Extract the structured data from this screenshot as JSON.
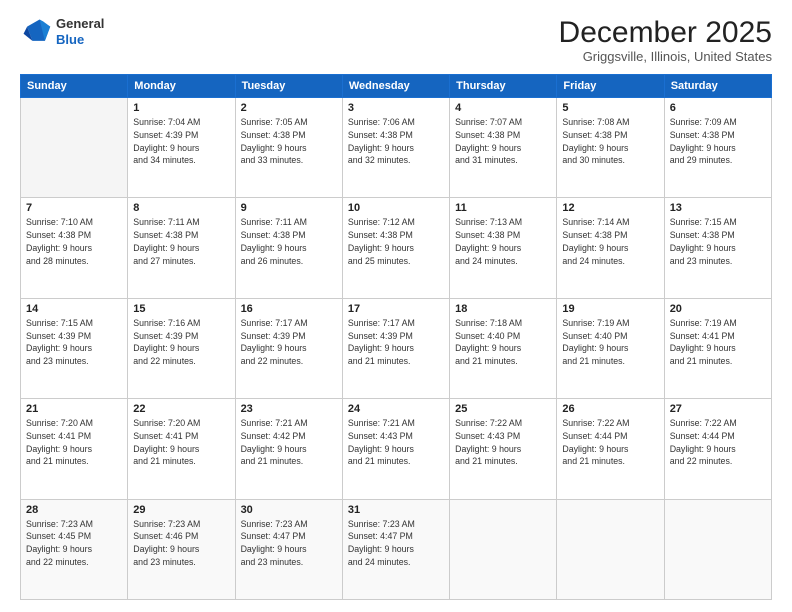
{
  "header": {
    "logo_line1": "General",
    "logo_line2": "Blue",
    "month_title": "December 2025",
    "location": "Griggsville, Illinois, United States"
  },
  "days_of_week": [
    "Sunday",
    "Monday",
    "Tuesday",
    "Wednesday",
    "Thursday",
    "Friday",
    "Saturday"
  ],
  "weeks": [
    [
      {
        "num": "",
        "info": ""
      },
      {
        "num": "1",
        "info": "Sunrise: 7:04 AM\nSunset: 4:39 PM\nDaylight: 9 hours\nand 34 minutes."
      },
      {
        "num": "2",
        "info": "Sunrise: 7:05 AM\nSunset: 4:38 PM\nDaylight: 9 hours\nand 33 minutes."
      },
      {
        "num": "3",
        "info": "Sunrise: 7:06 AM\nSunset: 4:38 PM\nDaylight: 9 hours\nand 32 minutes."
      },
      {
        "num": "4",
        "info": "Sunrise: 7:07 AM\nSunset: 4:38 PM\nDaylight: 9 hours\nand 31 minutes."
      },
      {
        "num": "5",
        "info": "Sunrise: 7:08 AM\nSunset: 4:38 PM\nDaylight: 9 hours\nand 30 minutes."
      },
      {
        "num": "6",
        "info": "Sunrise: 7:09 AM\nSunset: 4:38 PM\nDaylight: 9 hours\nand 29 minutes."
      }
    ],
    [
      {
        "num": "7",
        "info": "Sunrise: 7:10 AM\nSunset: 4:38 PM\nDaylight: 9 hours\nand 28 minutes."
      },
      {
        "num": "8",
        "info": "Sunrise: 7:11 AM\nSunset: 4:38 PM\nDaylight: 9 hours\nand 27 minutes."
      },
      {
        "num": "9",
        "info": "Sunrise: 7:11 AM\nSunset: 4:38 PM\nDaylight: 9 hours\nand 26 minutes."
      },
      {
        "num": "10",
        "info": "Sunrise: 7:12 AM\nSunset: 4:38 PM\nDaylight: 9 hours\nand 25 minutes."
      },
      {
        "num": "11",
        "info": "Sunrise: 7:13 AM\nSunset: 4:38 PM\nDaylight: 9 hours\nand 24 minutes."
      },
      {
        "num": "12",
        "info": "Sunrise: 7:14 AM\nSunset: 4:38 PM\nDaylight: 9 hours\nand 24 minutes."
      },
      {
        "num": "13",
        "info": "Sunrise: 7:15 AM\nSunset: 4:38 PM\nDaylight: 9 hours\nand 23 minutes."
      }
    ],
    [
      {
        "num": "14",
        "info": "Sunrise: 7:15 AM\nSunset: 4:39 PM\nDaylight: 9 hours\nand 23 minutes."
      },
      {
        "num": "15",
        "info": "Sunrise: 7:16 AM\nSunset: 4:39 PM\nDaylight: 9 hours\nand 22 minutes."
      },
      {
        "num": "16",
        "info": "Sunrise: 7:17 AM\nSunset: 4:39 PM\nDaylight: 9 hours\nand 22 minutes."
      },
      {
        "num": "17",
        "info": "Sunrise: 7:17 AM\nSunset: 4:39 PM\nDaylight: 9 hours\nand 21 minutes."
      },
      {
        "num": "18",
        "info": "Sunrise: 7:18 AM\nSunset: 4:40 PM\nDaylight: 9 hours\nand 21 minutes."
      },
      {
        "num": "19",
        "info": "Sunrise: 7:19 AM\nSunset: 4:40 PM\nDaylight: 9 hours\nand 21 minutes."
      },
      {
        "num": "20",
        "info": "Sunrise: 7:19 AM\nSunset: 4:41 PM\nDaylight: 9 hours\nand 21 minutes."
      }
    ],
    [
      {
        "num": "21",
        "info": "Sunrise: 7:20 AM\nSunset: 4:41 PM\nDaylight: 9 hours\nand 21 minutes."
      },
      {
        "num": "22",
        "info": "Sunrise: 7:20 AM\nSunset: 4:41 PM\nDaylight: 9 hours\nand 21 minutes."
      },
      {
        "num": "23",
        "info": "Sunrise: 7:21 AM\nSunset: 4:42 PM\nDaylight: 9 hours\nand 21 minutes."
      },
      {
        "num": "24",
        "info": "Sunrise: 7:21 AM\nSunset: 4:43 PM\nDaylight: 9 hours\nand 21 minutes."
      },
      {
        "num": "25",
        "info": "Sunrise: 7:22 AM\nSunset: 4:43 PM\nDaylight: 9 hours\nand 21 minutes."
      },
      {
        "num": "26",
        "info": "Sunrise: 7:22 AM\nSunset: 4:44 PM\nDaylight: 9 hours\nand 21 minutes."
      },
      {
        "num": "27",
        "info": "Sunrise: 7:22 AM\nSunset: 4:44 PM\nDaylight: 9 hours\nand 22 minutes."
      }
    ],
    [
      {
        "num": "28",
        "info": "Sunrise: 7:23 AM\nSunset: 4:45 PM\nDaylight: 9 hours\nand 22 minutes."
      },
      {
        "num": "29",
        "info": "Sunrise: 7:23 AM\nSunset: 4:46 PM\nDaylight: 9 hours\nand 23 minutes."
      },
      {
        "num": "30",
        "info": "Sunrise: 7:23 AM\nSunset: 4:47 PM\nDaylight: 9 hours\nand 23 minutes."
      },
      {
        "num": "31",
        "info": "Sunrise: 7:23 AM\nSunset: 4:47 PM\nDaylight: 9 hours\nand 24 minutes."
      },
      {
        "num": "",
        "info": ""
      },
      {
        "num": "",
        "info": ""
      },
      {
        "num": "",
        "info": ""
      }
    ]
  ]
}
